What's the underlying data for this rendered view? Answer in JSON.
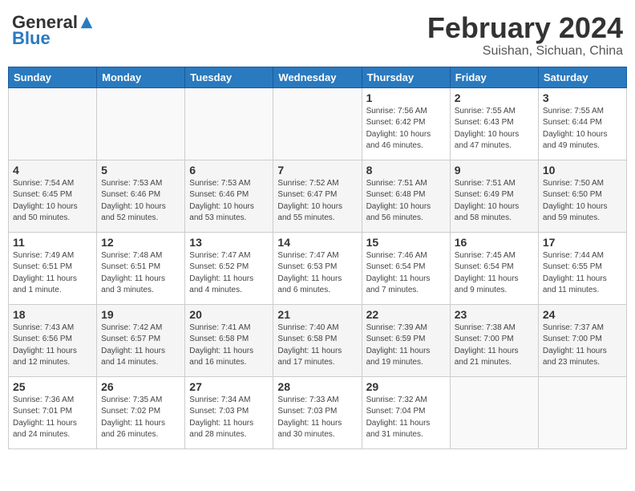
{
  "header": {
    "logo_general": "General",
    "logo_blue": "Blue",
    "month_title": "February 2024",
    "subtitle": "Suishan, Sichuan, China"
  },
  "weekdays": [
    "Sunday",
    "Monday",
    "Tuesday",
    "Wednesday",
    "Thursday",
    "Friday",
    "Saturday"
  ],
  "weeks": [
    [
      {
        "day": "",
        "info": ""
      },
      {
        "day": "",
        "info": ""
      },
      {
        "day": "",
        "info": ""
      },
      {
        "day": "",
        "info": ""
      },
      {
        "day": "1",
        "info": "Sunrise: 7:56 AM\nSunset: 6:42 PM\nDaylight: 10 hours\nand 46 minutes."
      },
      {
        "day": "2",
        "info": "Sunrise: 7:55 AM\nSunset: 6:43 PM\nDaylight: 10 hours\nand 47 minutes."
      },
      {
        "day": "3",
        "info": "Sunrise: 7:55 AM\nSunset: 6:44 PM\nDaylight: 10 hours\nand 49 minutes."
      }
    ],
    [
      {
        "day": "4",
        "info": "Sunrise: 7:54 AM\nSunset: 6:45 PM\nDaylight: 10 hours\nand 50 minutes."
      },
      {
        "day": "5",
        "info": "Sunrise: 7:53 AM\nSunset: 6:46 PM\nDaylight: 10 hours\nand 52 minutes."
      },
      {
        "day": "6",
        "info": "Sunrise: 7:53 AM\nSunset: 6:46 PM\nDaylight: 10 hours\nand 53 minutes."
      },
      {
        "day": "7",
        "info": "Sunrise: 7:52 AM\nSunset: 6:47 PM\nDaylight: 10 hours\nand 55 minutes."
      },
      {
        "day": "8",
        "info": "Sunrise: 7:51 AM\nSunset: 6:48 PM\nDaylight: 10 hours\nand 56 minutes."
      },
      {
        "day": "9",
        "info": "Sunrise: 7:51 AM\nSunset: 6:49 PM\nDaylight: 10 hours\nand 58 minutes."
      },
      {
        "day": "10",
        "info": "Sunrise: 7:50 AM\nSunset: 6:50 PM\nDaylight: 10 hours\nand 59 minutes."
      }
    ],
    [
      {
        "day": "11",
        "info": "Sunrise: 7:49 AM\nSunset: 6:51 PM\nDaylight: 11 hours\nand 1 minute."
      },
      {
        "day": "12",
        "info": "Sunrise: 7:48 AM\nSunset: 6:51 PM\nDaylight: 11 hours\nand 3 minutes."
      },
      {
        "day": "13",
        "info": "Sunrise: 7:47 AM\nSunset: 6:52 PM\nDaylight: 11 hours\nand 4 minutes."
      },
      {
        "day": "14",
        "info": "Sunrise: 7:47 AM\nSunset: 6:53 PM\nDaylight: 11 hours\nand 6 minutes."
      },
      {
        "day": "15",
        "info": "Sunrise: 7:46 AM\nSunset: 6:54 PM\nDaylight: 11 hours\nand 7 minutes."
      },
      {
        "day": "16",
        "info": "Sunrise: 7:45 AM\nSunset: 6:54 PM\nDaylight: 11 hours\nand 9 minutes."
      },
      {
        "day": "17",
        "info": "Sunrise: 7:44 AM\nSunset: 6:55 PM\nDaylight: 11 hours\nand 11 minutes."
      }
    ],
    [
      {
        "day": "18",
        "info": "Sunrise: 7:43 AM\nSunset: 6:56 PM\nDaylight: 11 hours\nand 12 minutes."
      },
      {
        "day": "19",
        "info": "Sunrise: 7:42 AM\nSunset: 6:57 PM\nDaylight: 11 hours\nand 14 minutes."
      },
      {
        "day": "20",
        "info": "Sunrise: 7:41 AM\nSunset: 6:58 PM\nDaylight: 11 hours\nand 16 minutes."
      },
      {
        "day": "21",
        "info": "Sunrise: 7:40 AM\nSunset: 6:58 PM\nDaylight: 11 hours\nand 17 minutes."
      },
      {
        "day": "22",
        "info": "Sunrise: 7:39 AM\nSunset: 6:59 PM\nDaylight: 11 hours\nand 19 minutes."
      },
      {
        "day": "23",
        "info": "Sunrise: 7:38 AM\nSunset: 7:00 PM\nDaylight: 11 hours\nand 21 minutes."
      },
      {
        "day": "24",
        "info": "Sunrise: 7:37 AM\nSunset: 7:00 PM\nDaylight: 11 hours\nand 23 minutes."
      }
    ],
    [
      {
        "day": "25",
        "info": "Sunrise: 7:36 AM\nSunset: 7:01 PM\nDaylight: 11 hours\nand 24 minutes."
      },
      {
        "day": "26",
        "info": "Sunrise: 7:35 AM\nSunset: 7:02 PM\nDaylight: 11 hours\nand 26 minutes."
      },
      {
        "day": "27",
        "info": "Sunrise: 7:34 AM\nSunset: 7:03 PM\nDaylight: 11 hours\nand 28 minutes."
      },
      {
        "day": "28",
        "info": "Sunrise: 7:33 AM\nSunset: 7:03 PM\nDaylight: 11 hours\nand 30 minutes."
      },
      {
        "day": "29",
        "info": "Sunrise: 7:32 AM\nSunset: 7:04 PM\nDaylight: 11 hours\nand 31 minutes."
      },
      {
        "day": "",
        "info": ""
      },
      {
        "day": "",
        "info": ""
      }
    ]
  ]
}
